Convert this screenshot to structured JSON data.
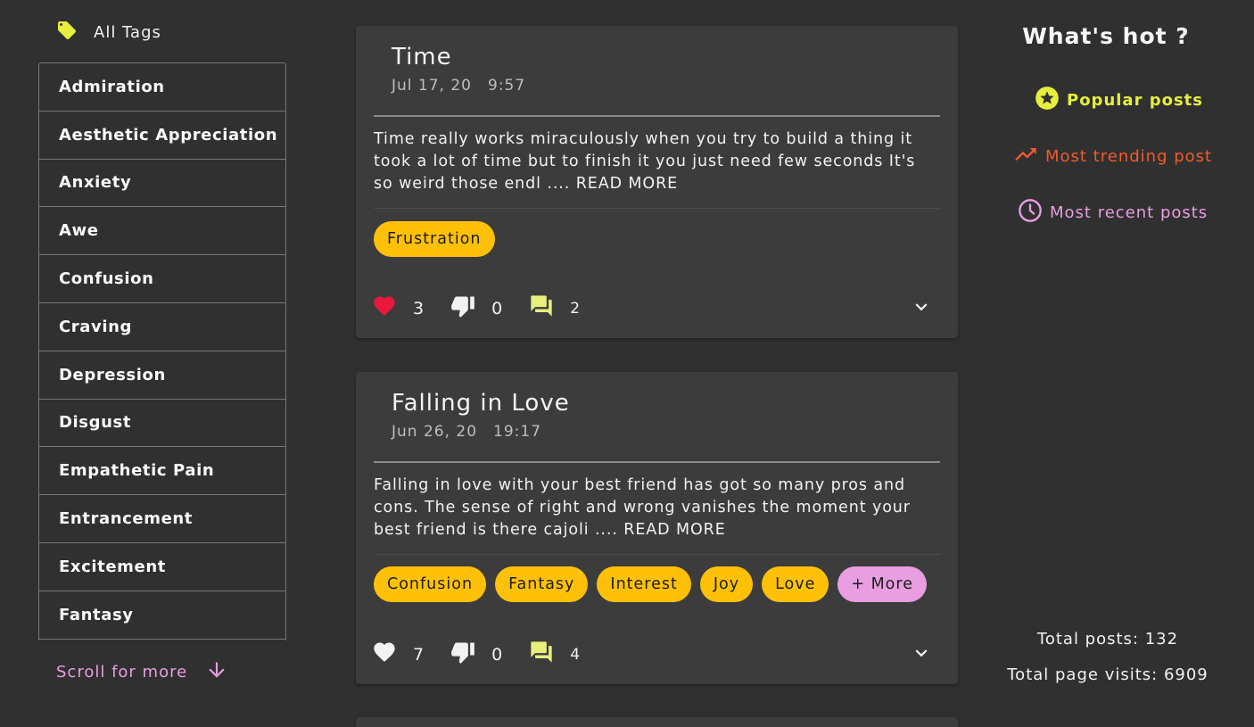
{
  "sidebar": {
    "all_tags_label": "All Tags",
    "tags": [
      "Admiration",
      "Aesthetic Appreciation",
      "Anxiety",
      "Awe",
      "Confusion",
      "Craving",
      "Depression",
      "Disgust",
      "Empathetic Pain",
      "Entrancement",
      "Excitement",
      "Fantasy"
    ],
    "scroll_more_label": "Scroll for more"
  },
  "posts": [
    {
      "title": "Time",
      "date": "Jul 17, 20",
      "time": "9:57",
      "excerpt": "Time really works miraculously when you try to build a thing it took a lot of time but to finish it you just need few seconds It's so weird those endl .... READ MORE",
      "tags": [
        "Frustration"
      ],
      "likes": "3",
      "dislikes": "0",
      "comments": "2",
      "liked": true
    },
    {
      "title": "Falling in Love",
      "date": "Jun 26, 20",
      "time": "19:17",
      "excerpt": "Falling in love with your best friend has got so many pros and cons. The sense of right and wrong vanishes the moment your best friend is there cajoli .... READ MORE",
      "tags": [
        "Confusion",
        "Fantasy",
        "Interest",
        "Joy",
        "Love"
      ],
      "more_label": "+ More",
      "likes": "7",
      "dislikes": "0",
      "comments": "4",
      "liked": false
    }
  ],
  "hot": {
    "title": "What's hot ?",
    "popular_label": "Popular posts",
    "trending_label": "Most trending post",
    "recent_label": "Most recent posts"
  },
  "stats": {
    "total_posts": "Total posts: 132",
    "total_visits": "Total page visits: 6909"
  },
  "colors": {
    "background": "#303030",
    "card": "#3c3c3c",
    "chip": "#ffc107",
    "chip_more": "#e89ee0",
    "popular": "#e6f03c",
    "trending": "#f25a2c",
    "recent": "#e89ee0",
    "heart_liked": "#e8173c"
  },
  "icons": {
    "all_tags": "tag-icon",
    "scroll": "arrow-down-icon",
    "like": "heart-icon",
    "dislike": "thumb-down-icon",
    "comment": "forum-icon",
    "expand": "chevron-down-icon",
    "popular": "star-circle-icon",
    "trending": "trending-up-icon",
    "recent": "clock-icon"
  }
}
